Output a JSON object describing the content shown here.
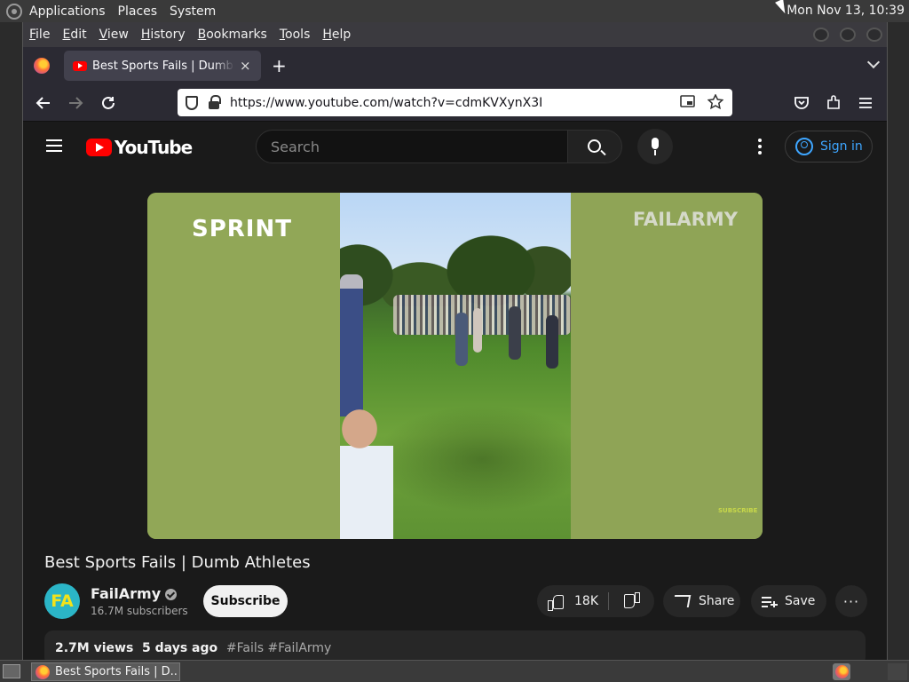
{
  "system_panel": {
    "menus": [
      "Applications",
      "Places",
      "System"
    ],
    "clock": "Mon Nov 13, 10:39"
  },
  "browser": {
    "menubar": [
      "File",
      "Edit",
      "View",
      "History",
      "Bookmarks",
      "Tools",
      "Help"
    ],
    "tab": {
      "title": "Best Sports Fails | Dumb Athletes",
      "close": "×"
    },
    "new_tab": "+",
    "url": "https://www.youtube.com/watch?v=cdmKVXynX3I"
  },
  "youtube": {
    "logo_text": "YouTube",
    "search_placeholder": "Search",
    "sign_in": "Sign in",
    "video": {
      "overlay_left": "SPRINT",
      "watermark": "FAILARMY",
      "subscribe_watermark": "SUBSCRIBE",
      "title": "Best Sports Fails | Dumb Athletes"
    },
    "channel": {
      "avatar_text": "FA",
      "name": "FailArmy",
      "subscribers": "16.7M subscribers",
      "subscribe_label": "Subscribe"
    },
    "actions": {
      "likes": "18K",
      "share": "Share",
      "save": "Save",
      "more": "···"
    },
    "description": {
      "views": "2.7M views",
      "age": "5 days ago",
      "tags": "#Fails #FailArmy"
    }
  },
  "taskbar": {
    "window_label": "Best Sports Fails | D..."
  },
  "colors": {
    "youtube_red": "#ff0000",
    "link_blue": "#3ea6ff",
    "page_bg": "#1a1a1a"
  }
}
